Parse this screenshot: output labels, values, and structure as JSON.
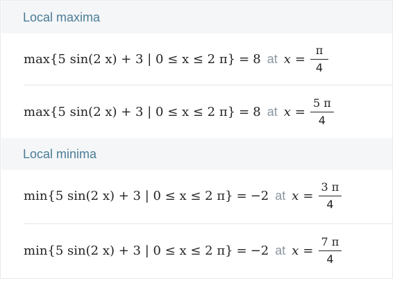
{
  "local_maxima": {
    "header": "Local maxima",
    "results": [
      {
        "func": "max",
        "expression": "{5 sin(2 x) + 3 | 0 ≤ x ≤ 2 π}",
        "equals": "=",
        "value": "8",
        "at": "at",
        "x_label": "x",
        "x_equals": "=",
        "numerator": "π",
        "denominator": "4"
      },
      {
        "func": "max",
        "expression": "{5 sin(2 x) + 3 | 0 ≤ x ≤ 2 π}",
        "equals": "=",
        "value": "8",
        "at": "at",
        "x_label": "x",
        "x_equals": "=",
        "numerator": "5 π",
        "denominator": "4"
      }
    ]
  },
  "local_minima": {
    "header": "Local minima",
    "results": [
      {
        "func": "min",
        "expression": "{5 sin(2 x) + 3 | 0 ≤ x ≤ 2 π}",
        "equals": "=",
        "value": "−2",
        "at": "at",
        "x_label": "x",
        "x_equals": "=",
        "numerator": "3 π",
        "denominator": "4"
      },
      {
        "func": "min",
        "expression": "{5 sin(2 x) + 3 | 0 ≤ x ≤ 2 π}",
        "equals": "=",
        "value": "−2",
        "at": "at",
        "x_label": "x",
        "x_equals": "=",
        "numerator": "7 π",
        "denominator": "4"
      }
    ]
  },
  "colors": {
    "header_text": "#4c7c95",
    "header_bg": "#f4f6f8",
    "at_text": "#8a96a0",
    "math_text": "#222222",
    "divider": "#e3e6e9"
  }
}
